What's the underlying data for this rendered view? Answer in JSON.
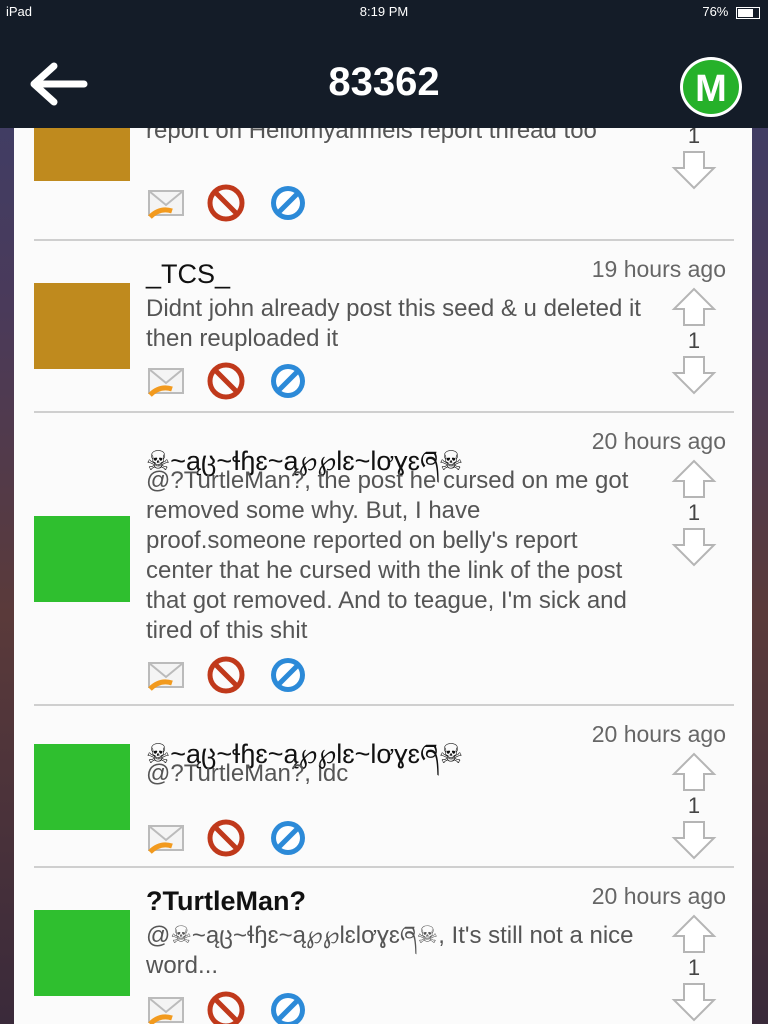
{
  "status_bar": {
    "device": "iPad",
    "time": "8:19 PM",
    "battery": "76%"
  },
  "header": {
    "title": "83362",
    "badge": "M",
    "back_icon": "back-arrow-icon"
  },
  "icons": {
    "reply": "reply-envelope-icon",
    "block": "block-icon",
    "report": "report-icon",
    "upvote": "upvote-arrow-icon",
    "downvote": "downvote-arrow-icon"
  },
  "colors": {
    "header_bg": "#141c28",
    "badge_green": "#26b12a",
    "block_red": "#c0391b",
    "report_blue": "#2c8ad8"
  },
  "comments": [
    {
      "user": "",
      "time": "",
      "text": "report on Hellomyanmeis report thread too",
      "votes": "1"
    },
    {
      "user": "_TCS_",
      "time": "19 hours ago",
      "text": "Didnt john already post this seed & u deleted it then reuploaded it",
      "votes": "1"
    },
    {
      "user": "☠~ąც~ɬɧɛ~ą℘℘Ɩɛ~Ɩơɣɛཞ☠",
      "time": "20 hours ago",
      "text": "@?TurtleMan?, the post he cursed on me got removed some why. But, I have proof.someone reported on belly's report center that he cursed with the link of the post that got removed. And to teague, I'm sick and tired of this shit",
      "votes": "1"
    },
    {
      "user": "☠~ąც~ɬɧɛ~ą℘℘Ɩɛ~Ɩơɣɛཞ☠",
      "time": "20 hours ago",
      "text": "@?TurtleMan?, idc",
      "votes": "1"
    },
    {
      "user": "?TurtleMan?",
      "time": "20 hours ago",
      "text": "@☠~ąც~ɬɧɛ~ą℘℘ƖɛƖơɣɛཞ☠, It's still not a nice word...",
      "votes": "1"
    }
  ]
}
